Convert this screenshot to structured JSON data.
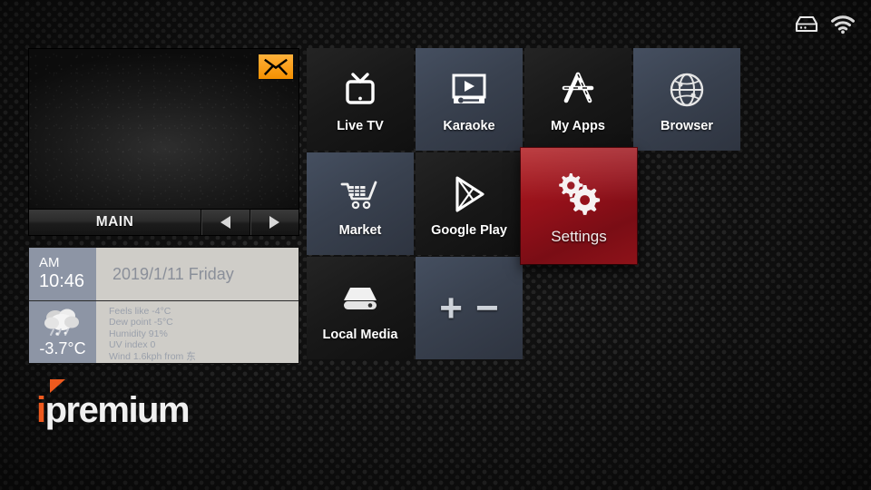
{
  "status_bar": {
    "icons": [
      {
        "name": "storage-icon",
        "label": "storage"
      },
      {
        "name": "wifi-icon",
        "label": "wifi"
      }
    ]
  },
  "preview": {
    "channel_label": "MAIN",
    "prev_label": "◀",
    "next_label": "▶",
    "mail_icon": "envelope-icon",
    "mail_color": "#f59000"
  },
  "widget": {
    "clock": {
      "ampm": "AM",
      "time": "10:46"
    },
    "date": "2019/1/11 Friday",
    "weather": {
      "icon": "cloud-snow-icon",
      "temperature": "-3.7°C",
      "details": [
        "Feels like  -4°C",
        "Dew point  -5°C",
        "Humidity  91%",
        "UV index  0",
        "Wind  1.6kph from 东"
      ]
    }
  },
  "logo": {
    "accent_letter": "i",
    "text": "premium",
    "accent_color": "#ef5a1e"
  },
  "grid": {
    "rows": [
      [
        {
          "label": "Live TV",
          "icon": "tv-icon",
          "style": "dark",
          "selected": false
        },
        {
          "label": "Karaoke",
          "icon": "media-player-icon",
          "style": "slate",
          "selected": false
        },
        {
          "label": "My Apps",
          "icon": "app-store-icon",
          "style": "dark",
          "selected": false
        },
        {
          "label": "Browser",
          "icon": "globe-icon",
          "style": "slate",
          "selected": false
        }
      ],
      [
        {
          "label": "Market",
          "icon": "shopping-cart-icon",
          "style": "slate",
          "selected": false
        },
        {
          "label": "Google Play",
          "icon": "google-play-icon",
          "style": "dark",
          "selected": false
        },
        {
          "label": "Settings",
          "icon": "gears-icon",
          "style": "red",
          "selected": true
        }
      ],
      [
        {
          "label": "Local Media",
          "icon": "hard-drive-icon",
          "style": "dark",
          "selected": false
        },
        {
          "label": "",
          "icon": "plus-minus-icon",
          "style": "slate",
          "selected": false
        }
      ]
    ],
    "add_label": "+",
    "remove_label": "−",
    "selected_tile_color": "#96111a"
  }
}
